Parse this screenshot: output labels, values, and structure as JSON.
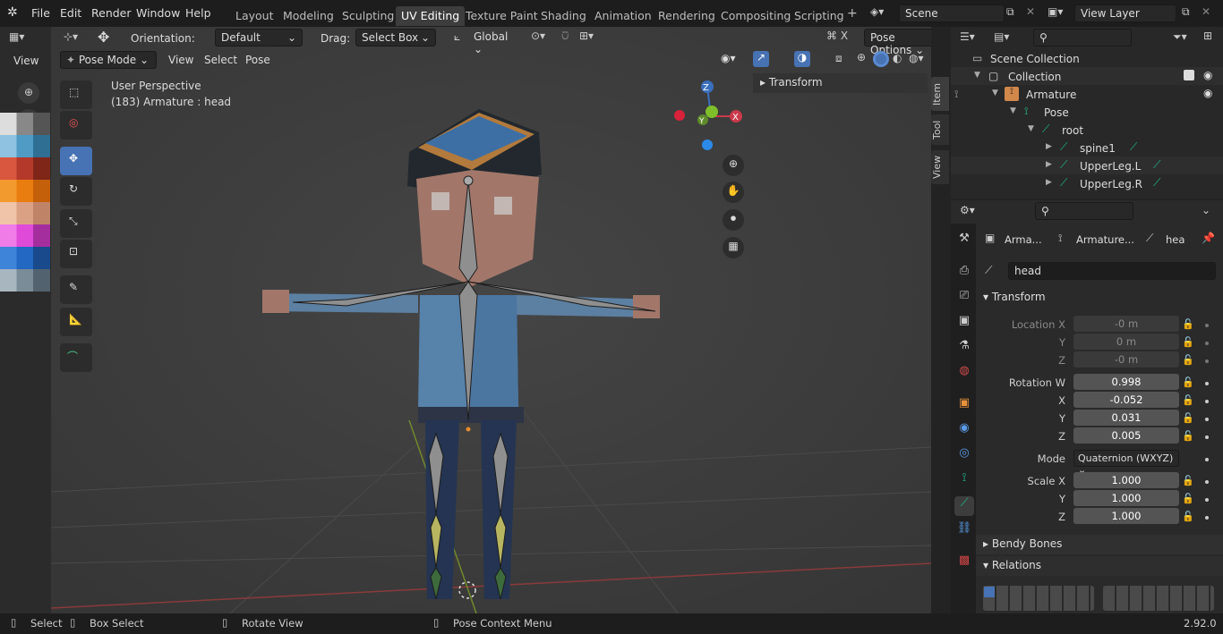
{
  "app": {
    "version": "2.92.0"
  },
  "menu": [
    "File",
    "Edit",
    "Render",
    "Window",
    "Help"
  ],
  "workspaces": [
    "Layout",
    "Modeling",
    "Sculpting",
    "UV Editing",
    "Texture Paint",
    "Shading",
    "Animation",
    "Rendering",
    "Compositing",
    "Scripting"
  ],
  "active_workspace": "UV Editing",
  "scene": "Scene",
  "view_layer": "View Layer",
  "header": {
    "orientation_label": "Orientation:",
    "orientation_value": "Default",
    "drag_label": "Drag:",
    "drag_value": "Select Box",
    "transform_space": "Global",
    "pose_options": "Pose Options"
  },
  "viewport_header": {
    "mode": "Pose Mode",
    "menus": [
      "View",
      "Select",
      "Pose"
    ]
  },
  "viewport": {
    "perspective": "User Perspective",
    "object_info": "(183) Armature : head",
    "sidebar_panel": "Transform",
    "gizmo_axes": [
      "X",
      "Y",
      "Z"
    ]
  },
  "sidebar_tabs": [
    "Item",
    "Tool",
    "View"
  ],
  "left_panel": {
    "view_label": "View"
  },
  "outliner": {
    "items": [
      {
        "label": "Scene Collection",
        "depth": 0
      },
      {
        "label": "Collection",
        "depth": 1
      },
      {
        "label": "Armature",
        "depth": 2
      },
      {
        "label": "Pose",
        "depth": 3
      },
      {
        "label": "root",
        "depth": 4
      },
      {
        "label": "spine1",
        "depth": 5
      },
      {
        "label": "UpperLeg.L",
        "depth": 5
      },
      {
        "label": "UpperLeg.R",
        "depth": 5
      }
    ]
  },
  "properties": {
    "breadcrumb": [
      "Arma...",
      "Armature...",
      "hea"
    ],
    "bone_name": "head",
    "transform_title": "Transform",
    "location": {
      "label": "Location X",
      "labels": [
        "Y",
        "Z"
      ],
      "values": [
        "-0 m",
        "0 m",
        "-0 m"
      ]
    },
    "rotation": {
      "label": "Rotation W",
      "labels": [
        "X",
        "Y",
        "Z"
      ],
      "values": [
        "0.998",
        "-0.052",
        "0.031",
        "0.005"
      ]
    },
    "mode_label": "Mode",
    "mode_value": "Quaternion (WXYZ)",
    "scale": {
      "label": "Scale X",
      "labels": [
        "Y",
        "Z"
      ],
      "values": [
        "1.000",
        "1.000",
        "1.000"
      ]
    },
    "bendy_bones": "Bendy Bones",
    "relations": "Relations"
  },
  "status": {
    "select": "Select",
    "box_select": "Box Select",
    "rotate_view": "Rotate View",
    "context_menu": "Pose Context Menu"
  },
  "colors": {
    "accent": "#4772b3",
    "active_bone": "#1fba8e"
  }
}
